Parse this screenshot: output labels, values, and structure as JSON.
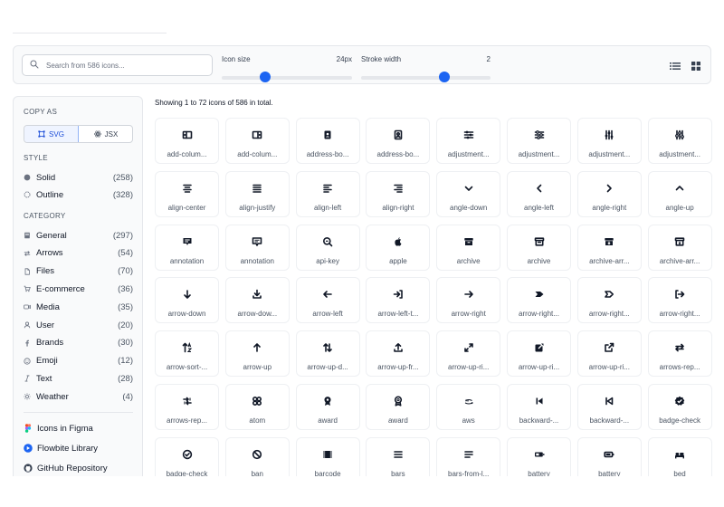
{
  "search": {
    "placeholder": "Search from 586 icons...",
    "value": ""
  },
  "icon_size": {
    "label": "Icon size",
    "value_text": "24px",
    "level": 0.33
  },
  "stroke_width": {
    "label": "Stroke width",
    "value_text": "2",
    "level": 0.64
  },
  "view_modes": [
    "list-view-icon",
    "grid-view-icon"
  ],
  "sidebar": {
    "copy_as_heading": "COPY AS",
    "copy_as": [
      {
        "label": "SVG",
        "icon": "svg-icon",
        "active": true
      },
      {
        "label": "JSX",
        "icon": "react-icon",
        "active": false
      }
    ],
    "style_heading": "STYLE",
    "style": [
      {
        "label": "Solid",
        "count": "(258)",
        "icon": "solid-dot-icon"
      },
      {
        "label": "Outline",
        "count": "(328)",
        "icon": "outline-dot-icon"
      }
    ],
    "category_heading": "CATEGORY",
    "categories": [
      {
        "label": "General",
        "count": "(297)",
        "icon": "book-icon"
      },
      {
        "label": "Arrows",
        "count": "(54)",
        "icon": "arrows-icon"
      },
      {
        "label": "Files",
        "count": "(70)",
        "icon": "file-icon"
      },
      {
        "label": "E-commerce",
        "count": "(36)",
        "icon": "cart-icon"
      },
      {
        "label": "Media",
        "count": "(35)",
        "icon": "video-icon"
      },
      {
        "label": "User",
        "count": "(20)",
        "icon": "user-icon"
      },
      {
        "label": "Brands",
        "count": "(30)",
        "icon": "facebook-icon"
      },
      {
        "label": "Emoji",
        "count": "(12)",
        "icon": "smile-icon"
      },
      {
        "label": "Text",
        "count": "(28)",
        "icon": "italic-icon"
      },
      {
        "label": "Weather",
        "count": "(4)",
        "icon": "sun-icon"
      }
    ],
    "links": [
      {
        "label": "Icons in Figma",
        "icon": "figma-icon"
      },
      {
        "label": "Flowbite Library",
        "icon": "flowbite-icon"
      },
      {
        "label": "GitHub Repository",
        "icon": "github-icon"
      }
    ]
  },
  "summary": "Showing 1 to 72 icons of 586 in total.",
  "icons": [
    {
      "name": "add-colum...",
      "glyph": "add-column-before"
    },
    {
      "name": "add-colum...",
      "glyph": "add-column-after"
    },
    {
      "name": "address-bo...",
      "glyph": "address-book-solid"
    },
    {
      "name": "address-bo...",
      "glyph": "address-book-outline"
    },
    {
      "name": "adjustment...",
      "glyph": "adjustments-horizontal-solid"
    },
    {
      "name": "adjustment...",
      "glyph": "adjustments-horizontal-outline"
    },
    {
      "name": "adjustment...",
      "glyph": "adjustments-vertical-solid"
    },
    {
      "name": "adjustment...",
      "glyph": "adjustments-vertical-outline"
    },
    {
      "name": "align-center",
      "glyph": "align-center"
    },
    {
      "name": "align-justify",
      "glyph": "align-justify"
    },
    {
      "name": "align-left",
      "glyph": "align-left"
    },
    {
      "name": "align-right",
      "glyph": "align-right"
    },
    {
      "name": "angle-down",
      "glyph": "angle-down"
    },
    {
      "name": "angle-left",
      "glyph": "angle-left"
    },
    {
      "name": "angle-right",
      "glyph": "angle-right"
    },
    {
      "name": "angle-up",
      "glyph": "angle-up"
    },
    {
      "name": "annotation",
      "glyph": "annotation-solid"
    },
    {
      "name": "annotation",
      "glyph": "annotation-outline"
    },
    {
      "name": "api-key",
      "glyph": "api-key"
    },
    {
      "name": "apple",
      "glyph": "apple"
    },
    {
      "name": "archive",
      "glyph": "archive-solid"
    },
    {
      "name": "archive",
      "glyph": "archive-outline"
    },
    {
      "name": "archive-arr...",
      "glyph": "archive-arrow-solid"
    },
    {
      "name": "archive-arr...",
      "glyph": "archive-arrow-outline"
    },
    {
      "name": "arrow-down",
      "glyph": "arrow-down"
    },
    {
      "name": "arrow-dow...",
      "glyph": "arrow-down-to-bracket"
    },
    {
      "name": "arrow-left",
      "glyph": "arrow-left"
    },
    {
      "name": "arrow-left-t...",
      "glyph": "arrow-left-to-bracket"
    },
    {
      "name": "arrow-right",
      "glyph": "arrow-right"
    },
    {
      "name": "arrow-right...",
      "glyph": "arrow-right-alt-solid"
    },
    {
      "name": "arrow-right...",
      "glyph": "arrow-right-alt-outline"
    },
    {
      "name": "arrow-right...",
      "glyph": "arrow-right-to-bracket"
    },
    {
      "name": "arrow-sort-...",
      "glyph": "arrow-sort-letters"
    },
    {
      "name": "arrow-up",
      "glyph": "arrow-up"
    },
    {
      "name": "arrow-up-d...",
      "glyph": "arrow-up-down"
    },
    {
      "name": "arrow-up-fr...",
      "glyph": "arrow-up-from-bracket"
    },
    {
      "name": "arrow-up-ri...",
      "glyph": "arrow-up-right-down-left"
    },
    {
      "name": "arrow-up-ri...",
      "glyph": "arrow-up-right-solid"
    },
    {
      "name": "arrow-up-ri...",
      "glyph": "arrow-up-right-outline"
    },
    {
      "name": "arrows-rep...",
      "glyph": "arrows-repeat"
    },
    {
      "name": "arrows-rep...",
      "glyph": "arrows-repeat-count"
    },
    {
      "name": "atom",
      "glyph": "atom"
    },
    {
      "name": "award",
      "glyph": "award-solid"
    },
    {
      "name": "award",
      "glyph": "award-outline"
    },
    {
      "name": "aws",
      "glyph": "aws"
    },
    {
      "name": "backward-...",
      "glyph": "backward-step-solid"
    },
    {
      "name": "backward-...",
      "glyph": "backward-step-outline"
    },
    {
      "name": "badge-check",
      "glyph": "badge-check"
    },
    {
      "name": "badge-check",
      "glyph": "badge-check-outline"
    },
    {
      "name": "ban",
      "glyph": "ban"
    },
    {
      "name": "barcode",
      "glyph": "barcode"
    },
    {
      "name": "bars",
      "glyph": "bars"
    },
    {
      "name": "bars-from-l...",
      "glyph": "bars-from-left"
    },
    {
      "name": "battery",
      "glyph": "battery-solid"
    },
    {
      "name": "battery",
      "glyph": "battery-outline"
    },
    {
      "name": "bed",
      "glyph": "bed"
    }
  ]
}
